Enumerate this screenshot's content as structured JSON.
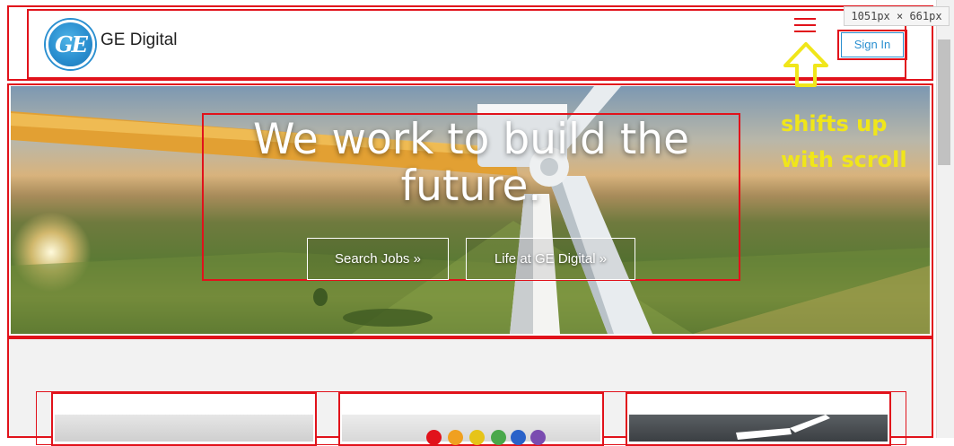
{
  "header": {
    "brand_name": "GE Digital",
    "logo_text": "GE",
    "signin_label": "Sign In"
  },
  "annotation": {
    "text": "shifts up with scroll"
  },
  "dimension_overlay": "1051px × 661px",
  "hero": {
    "title": "We work to build the future.",
    "buttons": [
      "Search Jobs »",
      "Life at GE Digital »"
    ]
  },
  "colors": {
    "highlight_red": "#e1121b",
    "ge_blue": "#2a8fd0",
    "annotation_yellow": "#f0e61a"
  },
  "icons": [
    "menu-icon",
    "up-arrow-icon",
    "ge-logo"
  ]
}
